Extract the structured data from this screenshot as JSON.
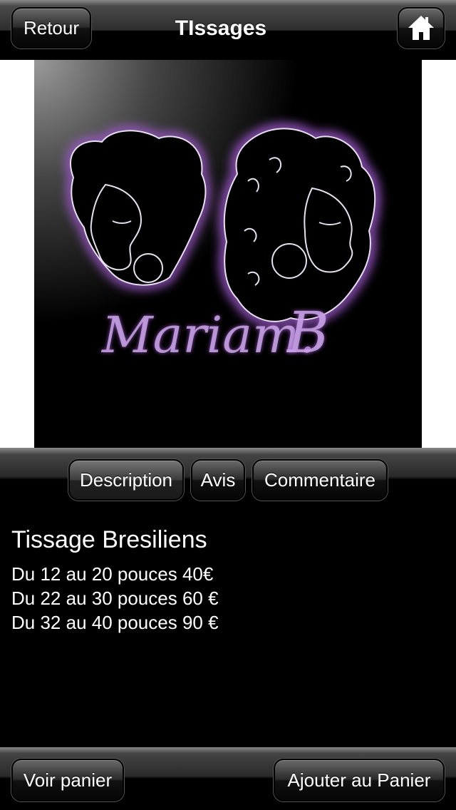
{
  "navbar": {
    "back_label": "Retour",
    "title": "TIssages",
    "home_icon": "home-icon"
  },
  "product_image": {
    "logo_text": "Mariam. B"
  },
  "tabs": [
    {
      "label": "Description",
      "active": true
    },
    {
      "label": "Avis",
      "active": false
    },
    {
      "label": "Commentaire",
      "active": false
    }
  ],
  "product": {
    "name": "Tissage Bresiliens",
    "lines": [
      "Du 12 au 20 pouces 40€",
      "Du 22 au 30 pouces 60 €",
      "Du 32 au 40 pouces 90 €"
    ]
  },
  "bottom": {
    "cart_label": "Voir panier",
    "add_label": "Ajouter au Panier"
  },
  "colors": {
    "accent_glow": "#9b59c9",
    "background": "#000000"
  }
}
